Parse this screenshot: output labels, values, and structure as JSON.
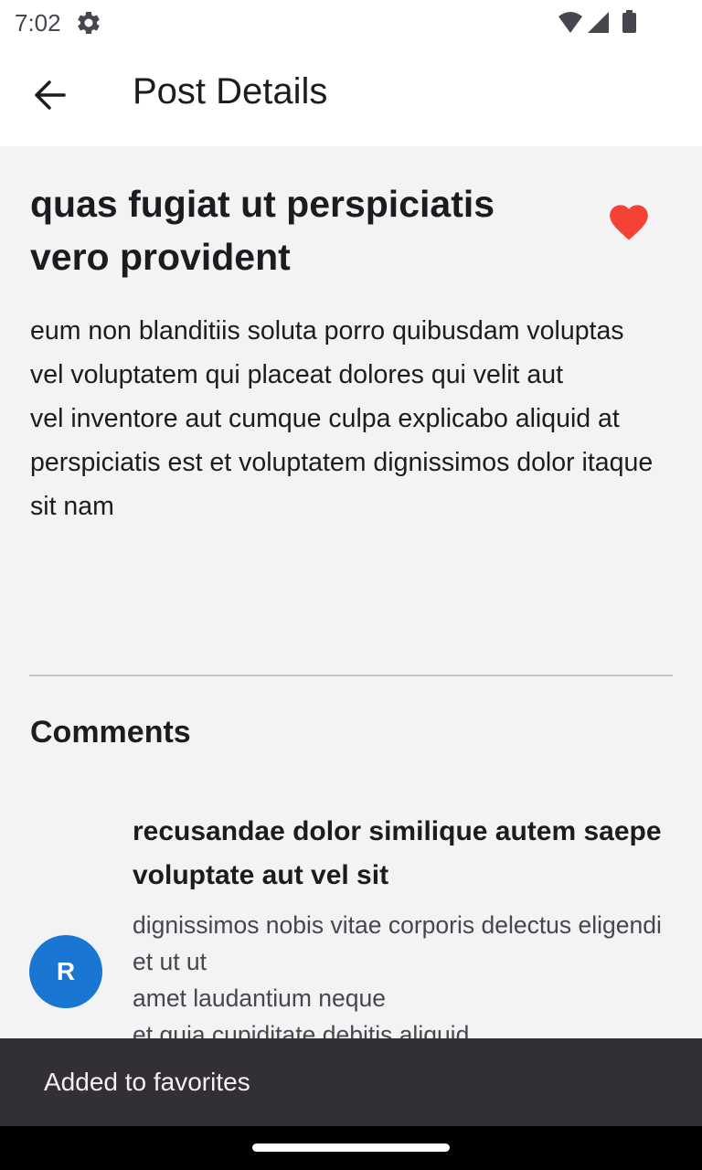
{
  "status_bar": {
    "time": "7:02"
  },
  "app_bar": {
    "title": "Post Details"
  },
  "post": {
    "title": "quas fugiat ut perspiciatis vero provident",
    "is_favorite": true,
    "body": "eum non blanditiis soluta porro quibusdam voluptas\nvel voluptatem qui placeat dolores qui velit aut\nvel inventore aut cumque culpa explicabo aliquid at\nperspiciatis est et voluptatem dignissimos dolor itaque sit nam"
  },
  "comments": {
    "heading": "Comments",
    "items": [
      {
        "avatar_letter": "R",
        "name": "recusandae dolor similique autem saepe voluptate aut vel sit",
        "body": "dignissimos nobis vitae corporis delectus eligendi et ut ut\namet laudantium neque\net quia cupiditate debitis aliquid"
      }
    ]
  },
  "snackbar": {
    "message": "Added to favorites"
  },
  "colors": {
    "favorite": "#f44336",
    "avatar": "#1976d2",
    "snackbar": "#322f35"
  },
  "icons": {
    "back": "arrow-back-icon",
    "favorite": "heart-icon",
    "settings": "gear-icon"
  }
}
